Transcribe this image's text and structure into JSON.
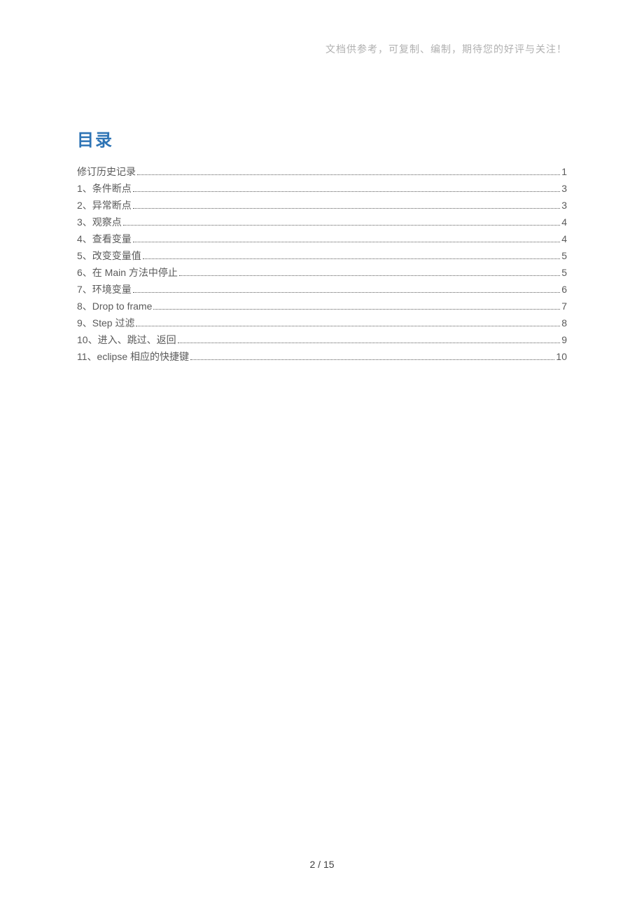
{
  "header_note": "文档供参考，可复制、编制，期待您的好评与关注！",
  "toc_title": "目录",
  "toc": [
    {
      "label": "修订历史记录",
      "page": "1"
    },
    {
      "label": "1、条件断点",
      "page": "3"
    },
    {
      "label": "2、异常断点",
      "page": "3"
    },
    {
      "label": "3、观察点",
      "page": "4"
    },
    {
      "label": "4、查看变量",
      "page": "4"
    },
    {
      "label": "5、改变变量值",
      "page": "5"
    },
    {
      "label": "6、在 Main 方法中停止",
      "page": "5"
    },
    {
      "label": "7、环境变量",
      "page": "6"
    },
    {
      "label": "8、Drop to frame",
      "page": "7"
    },
    {
      "label": "9、Step 过滤",
      "page": "8"
    },
    {
      "label": "10、进入、跳过、返回",
      "page": "9"
    },
    {
      "label": "11、eclipse 相应的快捷键",
      "page": "10"
    }
  ],
  "footer": "2 / 15"
}
